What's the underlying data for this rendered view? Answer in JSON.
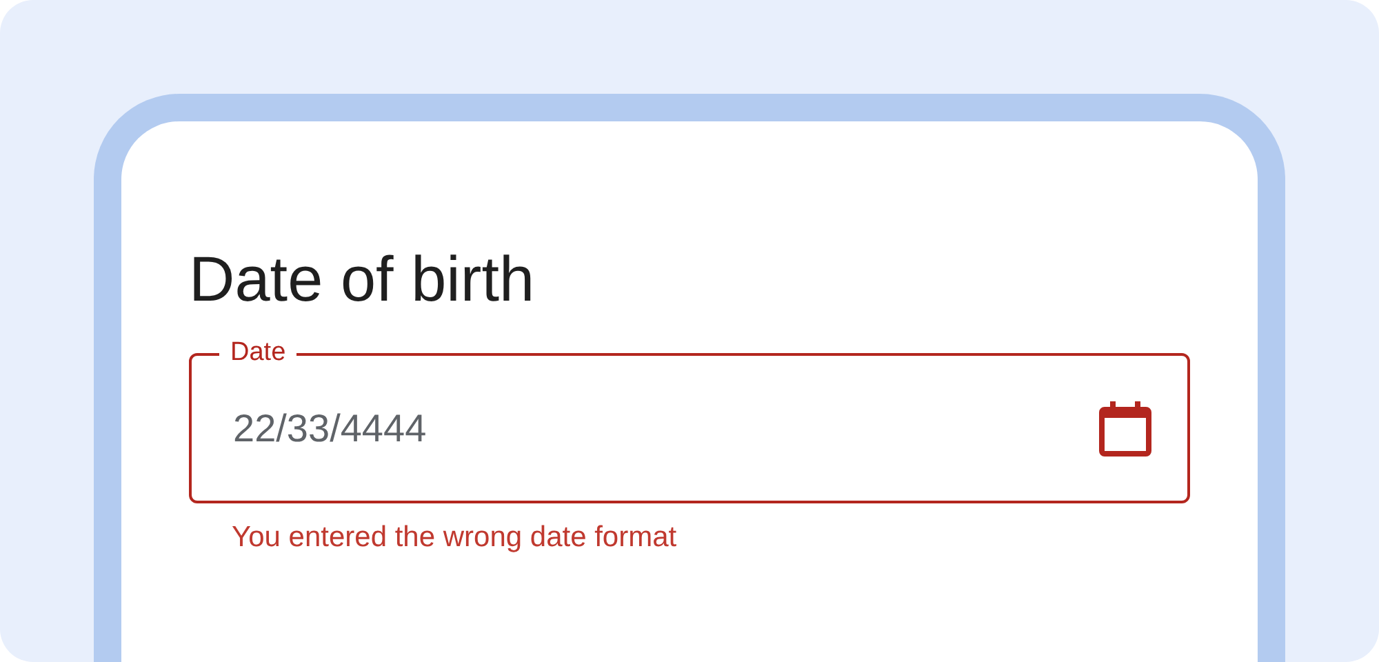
{
  "title": "Date of birth",
  "date_field": {
    "label": "Date",
    "value": "22/33/4444",
    "error": true,
    "error_text": "You entered the wrong date format"
  }
}
